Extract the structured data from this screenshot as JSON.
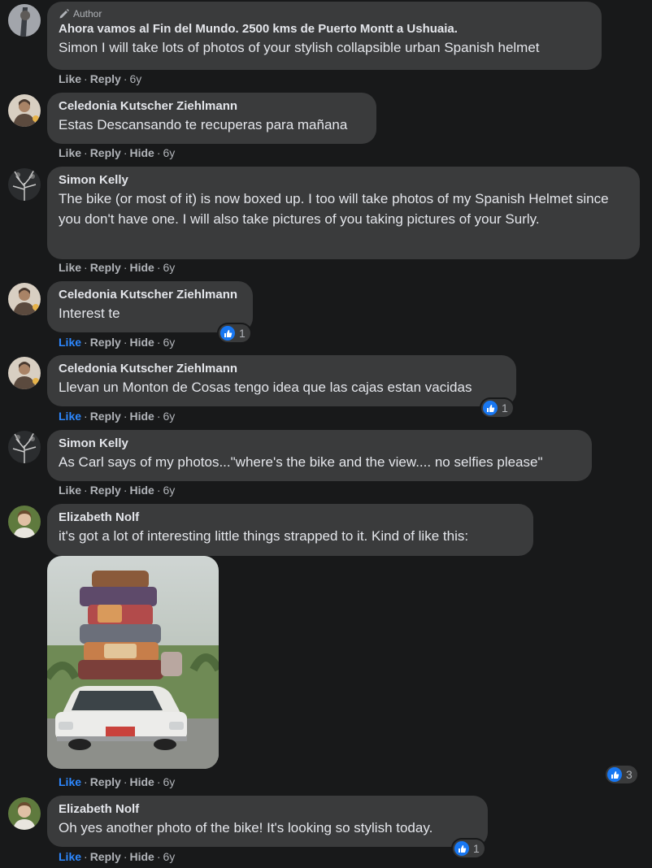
{
  "colors": {
    "background": "#18191a",
    "bubble": "#3a3b3c",
    "text": "#e4e6eb",
    "secondary": "#b0b3b8",
    "liked": "#2d88ff",
    "reaction_blue": "#1877f2"
  },
  "comments": [
    {
      "author_tag": "Author",
      "name": "Ahora vamos al Fin del Mundo. 2500 kms de Puerto Montt a Ushuaia.",
      "text": "Simon I will take lots of photos of your stylish collapsible urban Spanish helmet",
      "actions": {
        "like": "Like",
        "reply": "Reply",
        "time": "6y"
      }
    },
    {
      "name": "Celedonia Kutscher Ziehlmann",
      "text": "Estas Descansando te recuperas para mañana",
      "actions": {
        "like": "Like",
        "reply": "Reply",
        "hide": "Hide",
        "time": "6y"
      }
    },
    {
      "name": "Simon Kelly",
      "text": "The bike (or most of it) is now boxed up. I too will take photos of my Spanish Helmet since you don't have one. I will also take pictures of you taking pictures of your Surly.",
      "actions": {
        "like": "Like",
        "reply": "Reply",
        "hide": "Hide",
        "time": "6y"
      }
    },
    {
      "name": "Celedonia Kutscher Ziehlmann",
      "text": "Interest te",
      "actions": {
        "like": "Like",
        "reply": "Reply",
        "hide": "Hide",
        "time": "6y"
      },
      "reactions": 1
    },
    {
      "name": "Celedonia Kutscher Ziehlmann",
      "text": "Llevan un Monton de Cosas tengo idea que las cajas estan vacidas",
      "actions": {
        "like": "Like",
        "reply": "Reply",
        "hide": "Hide",
        "time": "6y"
      },
      "reactions": 1
    },
    {
      "name": "Simon Kelly",
      "text": "As Carl says of my photos...\"where's the bike and the view.... no selfies please\"",
      "actions": {
        "like": "Like",
        "reply": "Reply",
        "hide": "Hide",
        "time": "6y"
      }
    },
    {
      "name": "Elizabeth Nolf",
      "text": "it's got a lot of interesting little things strapped to it. Kind of like this:",
      "actions": {
        "like": "Like",
        "reply": "Reply",
        "hide": "Hide",
        "time": "6y"
      },
      "reactions": 3
    },
    {
      "name": "Elizabeth Nolf",
      "text": "Oh yes another photo of the bike! It's looking so stylish today.",
      "actions": {
        "like": "Like",
        "reply": "Reply",
        "hide": "Hide",
        "time": "6y"
      },
      "reactions": 1
    }
  ]
}
